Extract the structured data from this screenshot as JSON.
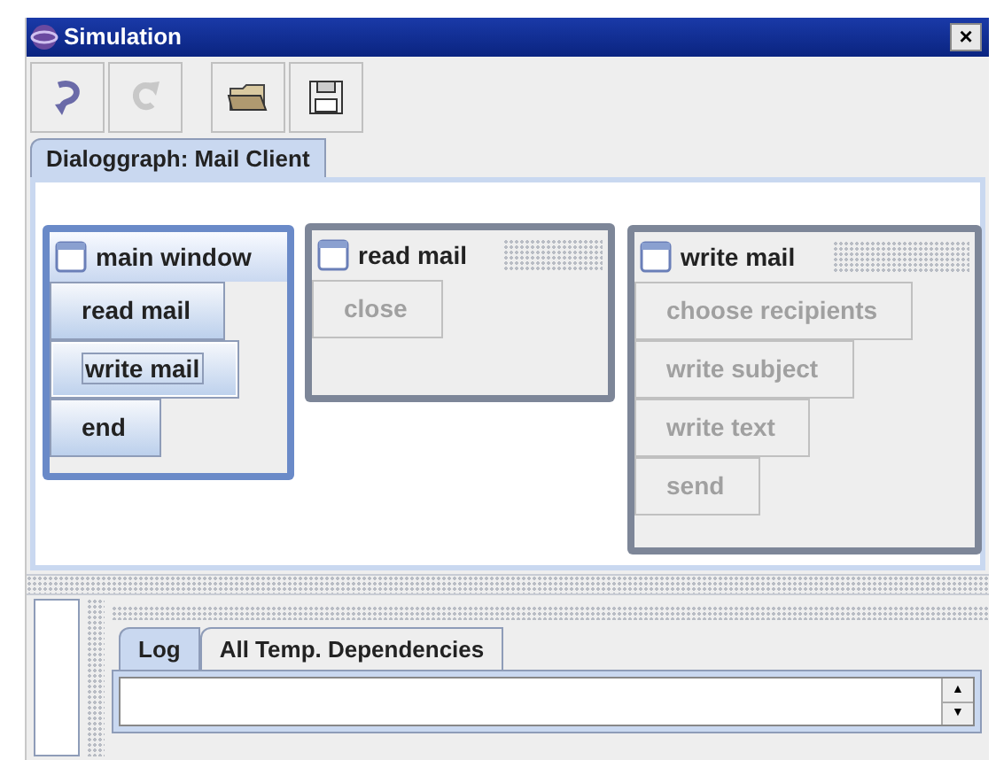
{
  "window": {
    "title": "Simulation",
    "close": "×"
  },
  "toolbar": [
    {
      "kind": "undo",
      "disabled": false
    },
    {
      "kind": "redo",
      "disabled": true
    },
    {
      "kind": "open",
      "disabled": false
    },
    {
      "kind": "save",
      "disabled": false
    }
  ],
  "graph_tabs": [
    {
      "label": "Dialoggraph: Mail Client",
      "selected": true
    }
  ],
  "nodes": [
    {
      "title": "main window",
      "active": true,
      "buttons": [
        {
          "label": "read mail",
          "disabled": false,
          "focused": false
        },
        {
          "label": "write mail",
          "disabled": false,
          "focused": true
        },
        {
          "label": "end",
          "disabled": false,
          "focused": false
        }
      ]
    },
    {
      "title": "read mail",
      "active": false,
      "buttons": [
        {
          "label": "close",
          "disabled": true,
          "focused": false
        }
      ]
    },
    {
      "title": "write mail",
      "active": false,
      "buttons": [
        {
          "label": "choose recipients",
          "disabled": true,
          "focused": false
        },
        {
          "label": "write subject",
          "disabled": true,
          "focused": false
        },
        {
          "label": "write text",
          "disabled": true,
          "focused": false
        },
        {
          "label": "send",
          "disabled": true,
          "focused": false
        }
      ]
    }
  ],
  "bottom_tabs": [
    {
      "label": "Log",
      "selected": true
    },
    {
      "label": "All Temp. Dependencies",
      "selected": false
    }
  ],
  "spinner": {
    "up": "▲",
    "down": "▼"
  }
}
